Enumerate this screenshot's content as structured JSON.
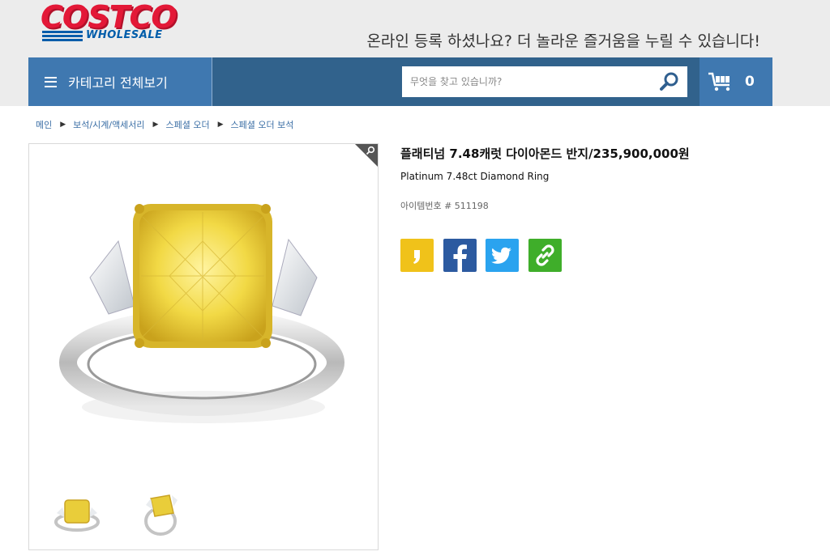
{
  "header": {
    "logo_top": "COSTCO",
    "logo_bottom": "WHOLESALE",
    "promo": "온라인 등록 하셨나요? 더 놀라운 즐거움을 누릴 수 있습니다!"
  },
  "nav": {
    "category_label": "카테고리 전체보기",
    "search_placeholder": "무엇을 찾고 있습니까?",
    "cart_count": "0"
  },
  "breadcrumb": [
    "메인",
    "보석/시계/액세서리",
    "스페셜 오더",
    "스페셜 오더 보석"
  ],
  "product": {
    "title_ko": "플래티넘 7.48캐럿 다이아몬드 반지/235,900,000원",
    "title_en": "Platinum 7.48ct Diamond Ring",
    "item_number": "아이템번호 # 511198"
  },
  "share": [
    {
      "name": "kakaostory",
      "icon": "kakaostory-icon"
    },
    {
      "name": "facebook",
      "icon": "facebook-icon"
    },
    {
      "name": "twitter",
      "icon": "twitter-icon"
    },
    {
      "name": "copy-link",
      "icon": "link-icon"
    }
  ],
  "colors": {
    "brand_red": "#e31837",
    "brand_blue": "#005daa",
    "nav_dark": "#31628c",
    "nav_light": "#3f78b0"
  }
}
